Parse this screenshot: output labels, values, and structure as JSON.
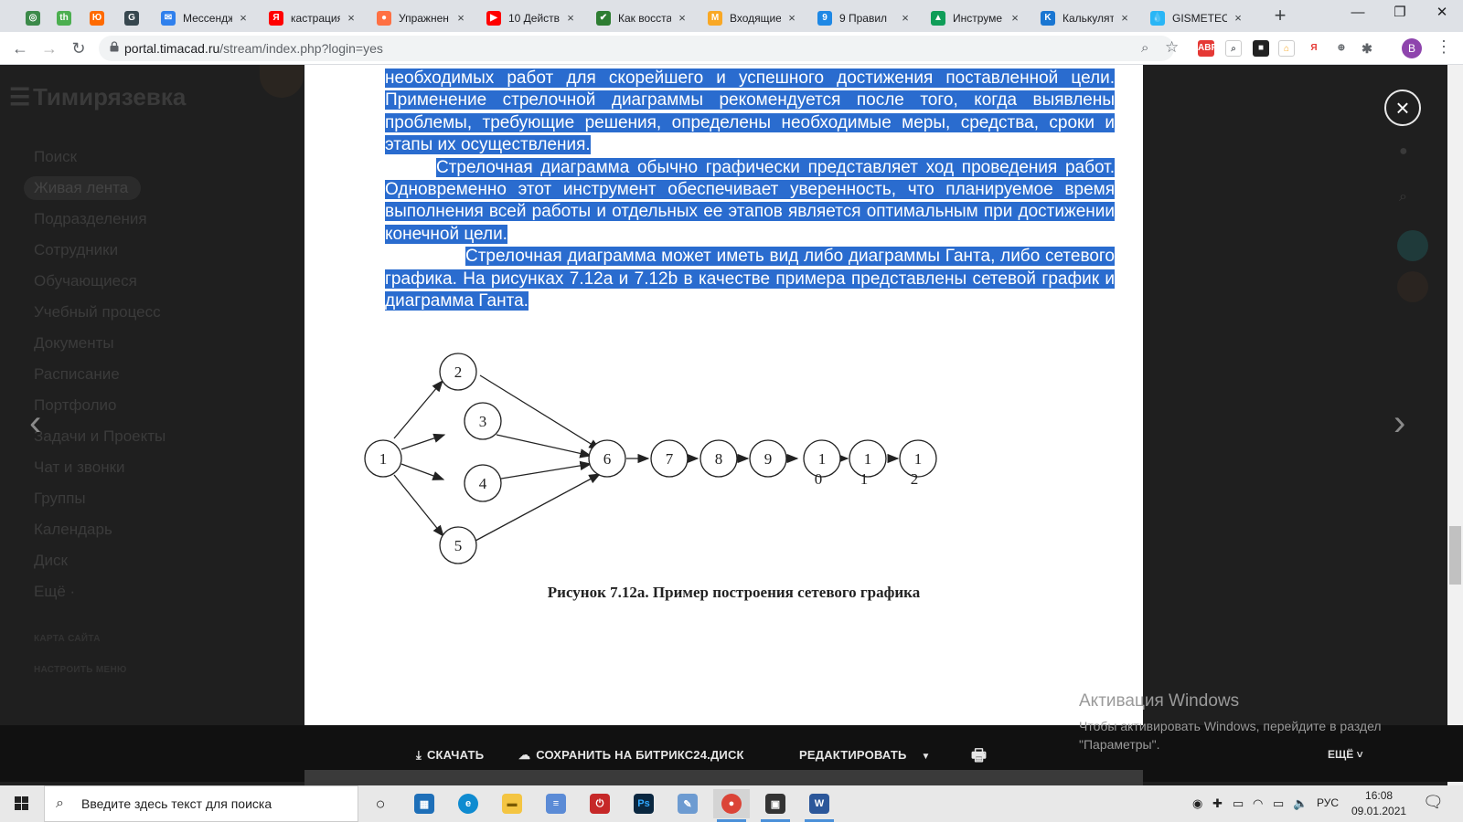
{
  "browser": {
    "tabs": [
      {
        "title": "",
        "color": "#3c8a4a",
        "glyph": "◎"
      },
      {
        "title": "",
        "color": "#4caf50",
        "glyph": "th"
      },
      {
        "title": "",
        "color": "#ff6a00",
        "glyph": "Ю"
      },
      {
        "title": "",
        "color": "#37474f",
        "glyph": "G"
      },
      {
        "title": "Мессендж",
        "color": "#2f80ed",
        "glyph": "✉"
      },
      {
        "title": "кастрация",
        "color": "#ff0000",
        "glyph": "Я"
      },
      {
        "title": "Упражнен",
        "color": "#ff7043",
        "glyph": "●"
      },
      {
        "title": "10 Действ",
        "color": "#ff0000",
        "glyph": "▶"
      },
      {
        "title": "Как восста",
        "color": "#2e7d32",
        "glyph": "✔"
      },
      {
        "title": "Входящие",
        "color": "#f9a825",
        "glyph": "M"
      },
      {
        "title": "9 Правил",
        "color": "#1e88e5",
        "glyph": "9"
      },
      {
        "title": "Инструме",
        "color": "#0f9d58",
        "glyph": "▲"
      },
      {
        "title": "Калькулят",
        "color": "#1976d2",
        "glyph": "K"
      },
      {
        "title": "GISMETEO",
        "color": "#29b6f6",
        "glyph": "💧"
      }
    ],
    "url_main": "portal.timacad.ru",
    "url_path": "/stream/index.php?login=yes",
    "profile_initial": "B",
    "window_controls": [
      "—",
      "❐",
      "✕"
    ]
  },
  "bitrix": {
    "brand": "Тимирязевка",
    "menu": [
      "Поиск",
      "Живая лента",
      "Подразделения",
      "Сотрудники",
      "Обучающиеся",
      "Учебный процесс",
      "Документы",
      "Расписание",
      "Портфолио",
      "Задачи и Проекты",
      "Чат и звонки",
      "Группы",
      "Календарь",
      "Диск",
      "Ещё ·"
    ],
    "active_index": 1,
    "footer_links": [
      "КАРТА САЙТА",
      "НАСТРОИТЬ МЕНЮ"
    ]
  },
  "document": {
    "paragraphs": [
      "необходимых работ для скорейшего и успешного достижения поставленной цели. Применение стрелочной диаграммы рекомендуется после того, когда выявлены проблемы, требующие решения, определены необходимые меры, средства, сроки и этапы их осуществления.",
      "Стрелочная диаграмма обычно графически представляет ход проведения работ. Одновременно этот инструмент обеспечивает уверенность, что планируемое время выполнения всей работы и отдельных ее этапов является оптимальным при достижении конечной цели.",
      "Стрелочная диаграмма может иметь вид либо диаграммы Ганта, либо сетевого графика. На рисунках 7.12a и 7.12b в качестве примера представлены сетевой график и диаграмма Ганта."
    ],
    "diagram_nodes": [
      "1",
      "2",
      "3",
      "4",
      "5",
      "6",
      "7",
      "8",
      "9",
      "1\n0",
      "1\n1",
      "1\n2"
    ],
    "caption": "Рисунок 7.12а. Пример построения сетевого графика",
    "highlight_color": "#2a6ccf"
  },
  "viewer": {
    "download": "СКАЧАТЬ",
    "save": "СОХРАНИТЬ НА БИТРИКС24.ДИСК",
    "edit": "РЕДАКТИРОВАТЬ",
    "more": "ЕЩЁ ˅"
  },
  "watermark": {
    "line1": "Активация Windows",
    "line2": "Чтобы активировать Windows, перейдите в раздел \"Параметры\"."
  },
  "taskbar": {
    "search_placeholder": "Введите здесь текст для поиска",
    "lang": "РУС",
    "time": "16:08",
    "date": "09.01.2021"
  }
}
